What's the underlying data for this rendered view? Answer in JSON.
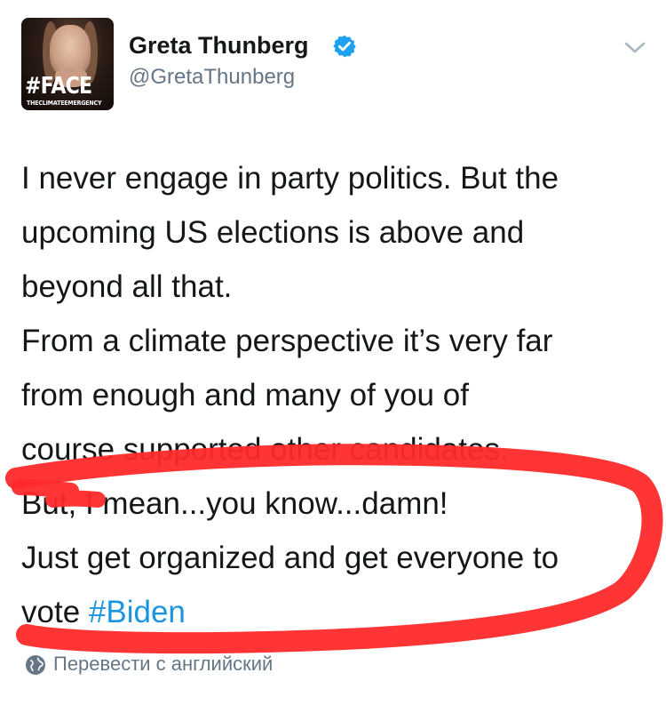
{
  "tweet": {
    "avatar": {
      "tag": "#FACE",
      "subtag": "THECLIMATEEMERGENCY"
    },
    "display_name": "Greta Thunberg",
    "handle": "@GretaThunberg",
    "verified_icon": "verified-badge-icon",
    "menu_icon": "chevron-down-icon",
    "text_lines": [
      "I never engage in party politics. But the",
      "upcoming US elections is above and",
      "beyond all that.",
      "From a climate perspective it’s very far",
      "from enough and many of you of",
      "course supported other candidates.",
      "But, I mean...you know...damn!",
      "Just get organized and get everyone to",
      "vote"
    ],
    "hashtag": "#Biden",
    "translate_label": "Перевести с английский",
    "translate_icon": "globe-icon",
    "colors": {
      "text": "#14171a",
      "secondary": "#657786",
      "link": "#1b95e0",
      "verified": "#1da1f2",
      "marker": "#ff2a2a"
    }
  }
}
